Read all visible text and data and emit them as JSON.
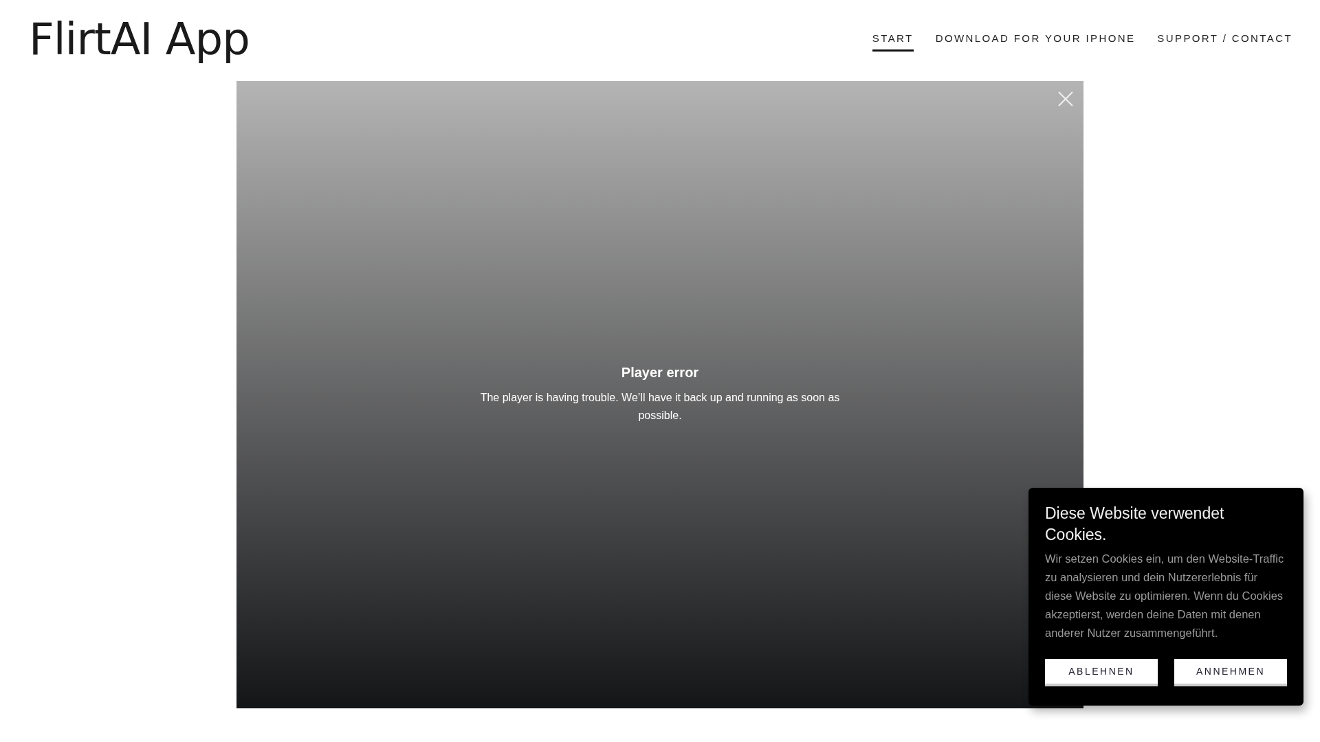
{
  "site": {
    "logo": "FlirtAI App"
  },
  "nav": [
    {
      "label": "START",
      "selected": true
    },
    {
      "label": "DOWNLOAD FOR YOUR IPHONE",
      "selected": false
    },
    {
      "label": "SUPPORT / CONTACT",
      "selected": false
    }
  ],
  "player": {
    "error_title": "Player error",
    "error_message": "The player is having trouble. We’ll have it back up and running as soon as possible."
  },
  "cookie_banner": {
    "title": "Diese Website verwendet Cookies.",
    "text": "Wir setzen Cookies ein, um den Website-Traffic zu analysieren und dein Nutzererlebnis für diese Website zu optimieren. Wenn du Cookies akzeptierst, werden deine Daten mit denen anderer Nutzer zusammengeführt.",
    "buttons": [
      "ABLEHNEN",
      "ANNEHMEN"
    ]
  }
}
